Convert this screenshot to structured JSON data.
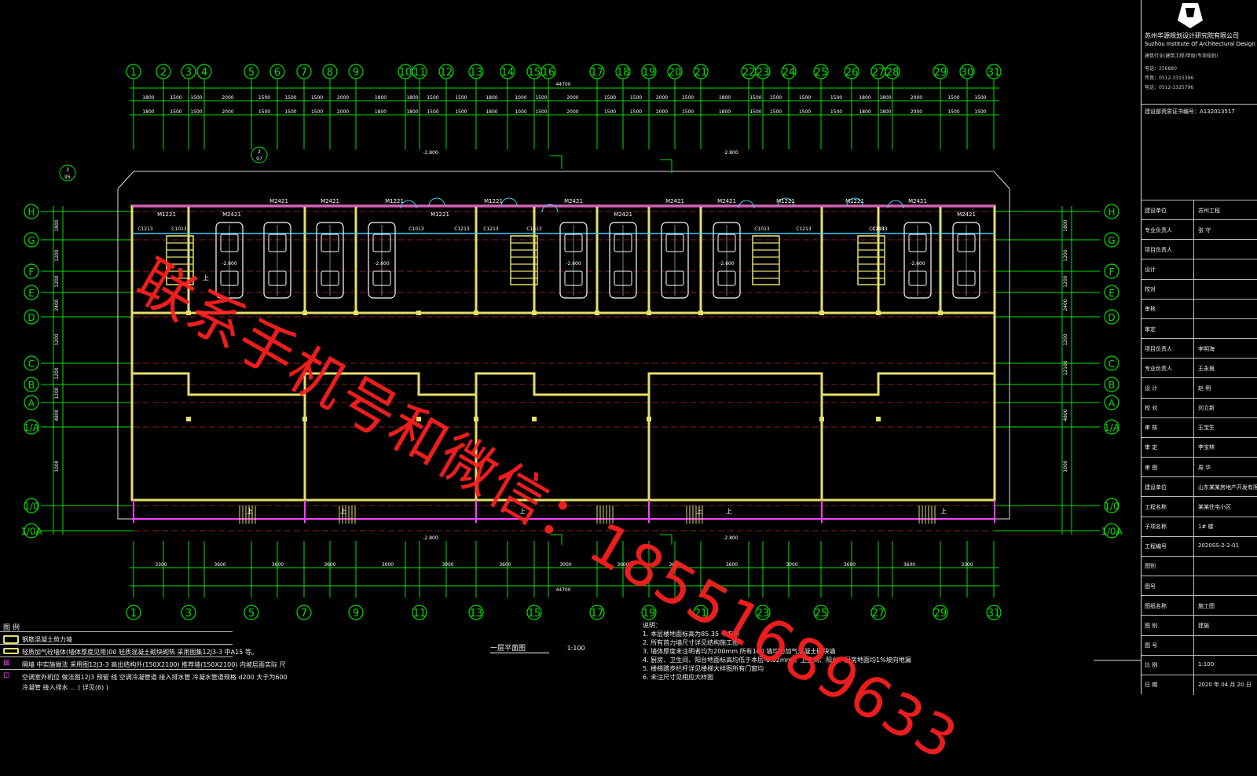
{
  "title_block": {
    "firm_cn": "苏州华源规划设计研究院有限公司",
    "firm_en": "Suzhou Institute Of Architectural Design",
    "cert": "建筑行业(建筑工程)甲级(专项规划)",
    "phone1": "电话：256880",
    "phone2": "传真：0512-3315396",
    "phone3": "电话：0512-3325796",
    "reg": "建设部资质证书编号：A132013517",
    "rows": [
      {
        "label": "建设单位",
        "value": "苏州工程"
      },
      {
        "label": "专业负责人",
        "value": "张 守"
      },
      {
        "label": "项目负责人",
        "value": ""
      },
      {
        "label": "设计",
        "value": ""
      },
      {
        "label": "校对",
        "value": ""
      },
      {
        "label": "审核",
        "value": ""
      },
      {
        "label": "审定",
        "value": ""
      },
      {
        "label": "项目负责人",
        "value": "李明海"
      },
      {
        "label": "专业负责人",
        "value": "王永根"
      },
      {
        "label": "设 计",
        "value": "赵 明"
      },
      {
        "label": "校 对",
        "value": "刘立新"
      },
      {
        "label": "审 核",
        "value": "王宝生"
      },
      {
        "label": "审 定",
        "value": "李宝林"
      },
      {
        "label": "审 图",
        "value": "周 华"
      },
      {
        "label": "建设单位",
        "value": "山东某某房地产开发有限公司"
      },
      {
        "label": "工程名称",
        "value": "某某住宅小区"
      },
      {
        "label": "子项名称",
        "value": "1# 楼"
      },
      {
        "label": "工程编号",
        "value": "2020SS-2-2-01"
      },
      {
        "label": "图别",
        "value": ""
      },
      {
        "label": "图号",
        "value": ""
      },
      {
        "label": "图纸名称",
        "value": "施工图"
      },
      {
        "label": "图 别",
        "value": "建施"
      },
      {
        "label": "图 号",
        "value": ""
      },
      {
        "label": "比 例",
        "value": "1:100"
      },
      {
        "label": "日 期",
        "value": "2020 年 04 月 20 日"
      }
    ]
  },
  "drawing": {
    "axis_top": [
      "1",
      "2",
      "3",
      "4",
      "5",
      "6",
      "7",
      "8",
      "9",
      "10",
      "11",
      "12",
      "13",
      "14",
      "15",
      "16",
      "17",
      "18",
      "19",
      "20",
      "21",
      "22",
      "23",
      "24",
      "25",
      "26",
      "27",
      "28",
      "29",
      "30",
      "31"
    ],
    "axis_bottom": [
      "1",
      "3",
      "5",
      "7",
      "9",
      "11",
      "13",
      "15",
      "17",
      "19",
      "21",
      "23",
      "25",
      "27",
      "29",
      "31"
    ],
    "axis_rows": [
      "H",
      "G",
      "F",
      "E",
      "D",
      "C",
      "B",
      "A",
      "1/A",
      "1/0",
      "1/0A"
    ],
    "overall_dim": "44700",
    "dims_top_row1": [
      "1800",
      "1500",
      "1500",
      "2000",
      "1500",
      "1500",
      "1500",
      "2000",
      "1800",
      "1800",
      "1500",
      "1500",
      "1800",
      "1000",
      "1500",
      "2000",
      "1500",
      "1500",
      "2000",
      "1500",
      "1800",
      "1500",
      "1500",
      "1500",
      "1500",
      "1800",
      "1800",
      "2000",
      "1500",
      "1500"
    ],
    "dims_bottom": [
      "3300",
      "3600",
      "3600",
      "3600",
      "3000",
      "3000",
      "3600",
      "3000",
      "3000",
      "3600",
      "3600",
      "3000",
      "3600",
      "3600",
      "3300"
    ],
    "door_tags": [
      "M2421",
      "M2421",
      "M2421",
      "M1221",
      "M1221",
      "M2421",
      "M2421",
      "M2421",
      "M2421",
      "M1221",
      "M1221",
      "M2421",
      "M2421",
      "M1221",
      "M1221"
    ],
    "win_tags": [
      "C1213",
      "C1013",
      "C1013",
      "C1213",
      "C1213",
      "C1013",
      "C1013",
      "C1213",
      "C1213",
      "C1013"
    ],
    "levels": [
      "-2.800",
      "-2.800",
      "-2.800",
      "-2.800",
      "-2.600",
      "-2.600",
      "-2.600",
      "-2.600",
      "-2.600"
    ],
    "labels_up": [
      "上",
      "上",
      "上",
      "上",
      "上",
      "上",
      "上"
    ],
    "side_dims_left": [
      "1800",
      "1200",
      "1200",
      "2400",
      "1200",
      "1200",
      "1200",
      "4800",
      "1000"
    ],
    "side_dims_right": [
      "1800",
      "1200",
      "1200",
      "2400",
      "1200",
      "12100",
      "4800",
      "1000"
    ],
    "index_marks": [
      "3",
      "95",
      "2",
      "97"
    ]
  },
  "plan_title": "一层平面图",
  "plan_scale": "1:100",
  "notes_title": "说明：",
  "notes": [
    "1. 本层楼地面标高为85.35   平方米",
    "2. 所有首力墙尺寸详见结构施工图",
    "3. 墙体厚度未注明者均为200mm      所有100   墙均为加气混凝土砌块墙",
    "4. 厨房、卫生间、阳台地面标高均低于本层-0.02mm    ，卫生间、阳台、厨房地面均1%坡向地漏",
    "5. 楼梯踏步栏杆详见楼梯大样图所有门窗均",
    "6. 未注尺寸见相应大样图"
  ],
  "legend_title": "图 例",
  "legend": [
    "钢筋混凝土剪力墙",
    "轻质加气砼墙体(墙体厚度见用)00 轻质混凝土砌块砌筑 采用图集12J3-3     中A15 等。",
    "隔墙 中实施做法 采用图12J3-3  高出结构外(150X2100)   推荐墙(150X2100)   内坡层面实际 尺",
    "空调室外机位 做法图12J3  预留 线 空调冷凝管道 接入排水管 冷凝水管道规格 d200  大于为600",
    "冷凝管 接入排水 ...  ( 详见(6)   )"
  ],
  "watermark": "联系手机号和微信：18551689633",
  "colors": {
    "axis": "#00e000",
    "wall": "#e5e06a",
    "dim": "#ffffff",
    "door": "#ff40ff",
    "window": "#40d0ff",
    "red": "#ff2020"
  }
}
